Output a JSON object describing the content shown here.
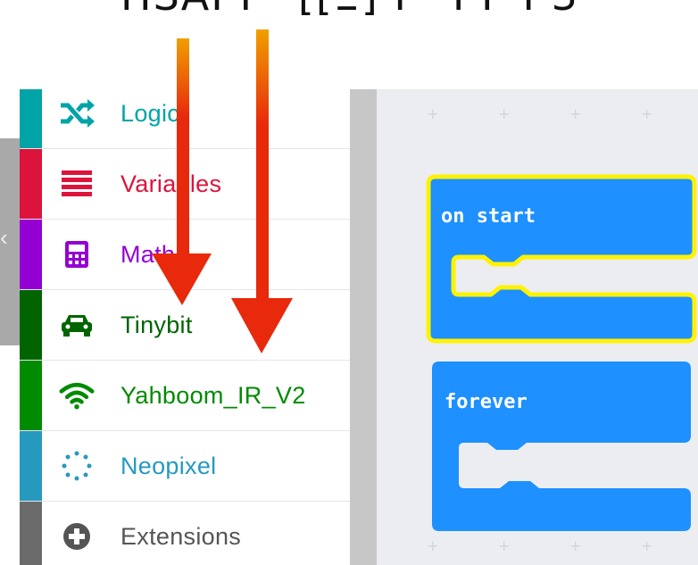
{
  "banner": {
    "text": "HSAI  I  ·  [[...]]  I  ·  I  · I  ·  I  ·  I  ·  ;"
  },
  "toolbox": {
    "categories": [
      {
        "label": "Logic",
        "color": "#00a4a6",
        "icon": "shuffle-icon"
      },
      {
        "label": "Variables",
        "color": "#dc143c",
        "icon": "list-icon"
      },
      {
        "label": "Math",
        "color": "#9400d3",
        "icon": "calculator-icon"
      },
      {
        "label": "Tinybit",
        "color": "#006400",
        "icon": "car-icon"
      },
      {
        "label": "Yahboom_IR_V2",
        "color": "#008b00",
        "icon": "wifi-icon"
      },
      {
        "label": "Neopixel",
        "color": "#2699bf",
        "icon": "dots-circle-icon"
      },
      {
        "label": "Extensions",
        "color": "#6b6b6b",
        "icon": "plus-circle-icon"
      }
    ]
  },
  "workspace": {
    "blocks": [
      {
        "label": "on start",
        "color": "#1e90ff",
        "selected": true
      },
      {
        "label": "forever",
        "color": "#1e90ff",
        "selected": false
      }
    ]
  },
  "overlay": {
    "arrow_color": "#e8290c"
  }
}
